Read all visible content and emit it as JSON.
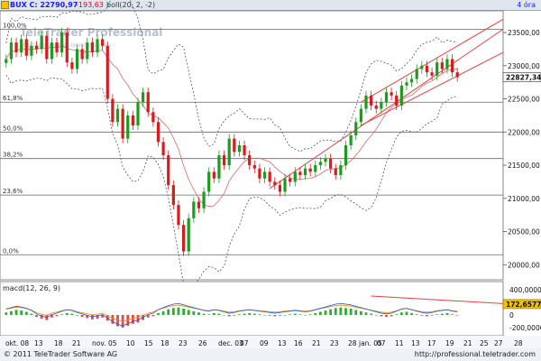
{
  "header": {
    "symbol_label": "BUX C: 22790,97",
    "change_label": "-193,63",
    "indicator_label": "boll(20, 2, -2)",
    "timeframe_label": "4 óra",
    "colors": {
      "symbol": "#1a1aff",
      "change": "#e0001a",
      "indicator": "#333333"
    }
  },
  "watermark": {
    "brand": "TeleTrader Professional",
    "url": "http://professional.teletrader.com"
  },
  "macd_panel": {
    "label": "macd(12, 26, 9)",
    "last_value_label": "172,6577"
  },
  "footer": {
    "copyright": "© 2011 TeleTrader Software AG",
    "url": "http://professional.teletrader.com"
  },
  "chart_data": [
    {
      "type": "candlestick",
      "title": "",
      "y_axis": {
        "ticks": [
          20000,
          20500,
          21000,
          21500,
          22000,
          22500,
          23000,
          23500
        ],
        "tick_labels": [
          "20000,00",
          "20500,00",
          "21000,00",
          "21500,00",
          "22000,00",
          "22500,00",
          "23000,00",
          "23500,00"
        ],
        "range": [
          19800,
          23800
        ]
      },
      "x_axis": {
        "tick_labels": [
          "okt. 08",
          "13",
          "18",
          "21",
          "nov. 05",
          "10",
          "15",
          "18",
          "23",
          "26",
          "dec. 03",
          "07",
          "09",
          "13",
          "16",
          "21",
          "23",
          "28",
          "jan. 05",
          "07",
          "11",
          "13",
          "17",
          "19",
          "21",
          "25",
          "27",
          "28"
        ]
      },
      "fibonacci_levels": [
        {
          "label": "100,0%",
          "value": 23550
        },
        {
          "label": "61,8%",
          "value": 22450
        },
        {
          "label": "50,0%",
          "value": 22000
        },
        {
          "label": "38,2%",
          "value": 21600
        },
        {
          "label": "23,6%",
          "value": 21050
        },
        {
          "label": "0,0%",
          "value": 20150
        }
      ],
      "close_series": [
        23100,
        23350,
        23200,
        23400,
        23150,
        23300,
        23250,
        23450,
        23100,
        23350,
        23200,
        23500,
        23050,
        22950,
        23250,
        23100,
        23350,
        23200,
        23400,
        23300,
        22500,
        22150,
        22350,
        21900,
        22250,
        22100,
        22450,
        22600,
        22300,
        22150,
        21850,
        21650,
        21200,
        20900,
        20600,
        20200,
        20700,
        20950,
        20850,
        21100,
        21400,
        21300,
        21650,
        21500,
        21900,
        21700,
        21800,
        21650,
        21500,
        21450,
        21300,
        21400,
        21250,
        21200,
        21100,
        21300,
        21250,
        21400,
        21350,
        21450,
        21400,
        21500,
        21550,
        21600,
        21450,
        21350,
        21500,
        21800,
        21950,
        22150,
        22350,
        22550,
        22400,
        22350,
        22450,
        22600,
        22550,
        22400,
        22700,
        22750,
        22800,
        22950,
        23000,
        22900,
        22850,
        23050,
        22950,
        23100,
        22900,
        22827
      ],
      "last_price_label": "22827,34",
      "colors": {
        "up": "#1c9c1c",
        "down": "#d81b1b",
        "bollinger": "#44557a",
        "channel": "#e84040",
        "fib": "#666666"
      }
    },
    {
      "type": "bar",
      "title": "macd(12, 26, 9)",
      "y_axis": {
        "ticks": [
          400000,
          0,
          -200000
        ],
        "tick_labels": [
          "400,0000",
          "0",
          "-200,0000"
        ],
        "range": [
          -300000,
          500000
        ]
      },
      "histogram": [
        40,
        60,
        80,
        70,
        50,
        20,
        -30,
        -60,
        -80,
        -40,
        -20,
        10,
        30,
        20,
        -10,
        -30,
        -50,
        -70,
        -60,
        -40,
        -90,
        -140,
        -180,
        -200,
        -170,
        -140,
        -120,
        -80,
        -40,
        -20,
        30,
        60,
        90,
        110,
        120,
        100,
        80,
        60,
        40,
        20,
        10,
        30,
        20,
        0,
        -20,
        -10,
        10,
        20,
        30,
        20,
        10,
        0,
        -10,
        -20,
        -10,
        0,
        10,
        20,
        10,
        0,
        10,
        30,
        50,
        70,
        90,
        110,
        120,
        110,
        100,
        80,
        60,
        40,
        20,
        0,
        -20,
        -30,
        -20,
        10,
        40,
        50,
        30,
        10,
        -10,
        -20,
        -10,
        10,
        20,
        30,
        10,
        0
      ],
      "last_value_label": "172,6577",
      "colors": {
        "up": "#33aa33",
        "down": "#ee4444",
        "macd": "#2255dd",
        "signal": "#ee8800"
      }
    }
  ]
}
